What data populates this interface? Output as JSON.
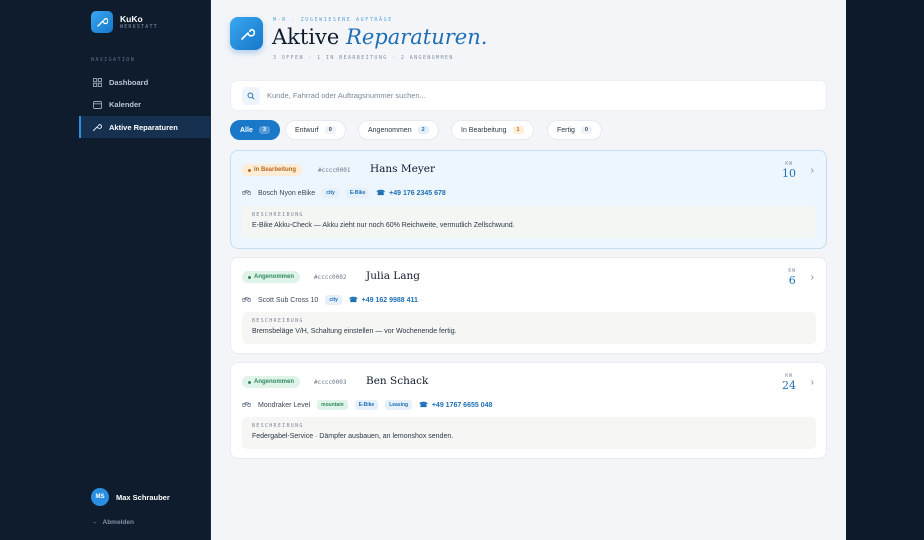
{
  "brand": {
    "name": "KuKo",
    "sub": "WERKSTATT"
  },
  "nav": {
    "heading": "NAVIGATION",
    "items": [
      {
        "label": "Dashboard",
        "icon": "dashboard-icon"
      },
      {
        "label": "Kalender",
        "icon": "calendar-icon"
      },
      {
        "label": "Aktive Reparaturen",
        "icon": "wrench-icon",
        "active": true
      }
    ]
  },
  "user": {
    "initials": "MS",
    "name": "Max Schrauber",
    "logout": "Abmelden"
  },
  "header": {
    "eyebrow": "M-R · ZUGEWIESENE AUFTRÄGE",
    "title_plain": "Aktive",
    "title_accent": "Reparaturen.",
    "subline": "3 OFFEN · 1 IN BEARBEITUNG · 2 ANGENOMMEN"
  },
  "search": {
    "placeholder": "Kunde, Fahrrad oder Auftragsnummer suchen..."
  },
  "filters": [
    {
      "label": "Alle",
      "count": "3",
      "active": true
    },
    {
      "label": "Entwurf",
      "count": "0"
    },
    {
      "label": "Angenommen",
      "count": "2"
    },
    {
      "label": "In Bearbeitung",
      "count": "1"
    },
    {
      "label": "Fertig",
      "count": "0"
    }
  ],
  "desc_label": "BESCHREIBUNG",
  "kw_label": "KW",
  "cards": [
    {
      "status": "In Bearbeitung",
      "order": "#cccc0001",
      "name": "Hans Meyer",
      "bike": "Bosch Nyon eBike",
      "tags": [
        "city",
        "E-Bike"
      ],
      "phone": "+49 176 2345 678",
      "description": "E-Bike Akku-Check — Akku zieht nur noch 60% Reichweite, vermutlich Zellschwund.",
      "kw": "10"
    },
    {
      "status": "Angenommen",
      "order": "#cccc0002",
      "name": "Julia Lang",
      "bike": "Scott Sub Cross 10",
      "tags": [
        "city"
      ],
      "phone": "+49 162 9988 411",
      "description": "Bremsbeläge V/H, Schaltung einstellen — vor Wochenende fertig.",
      "kw": "6"
    },
    {
      "status": "Angenommen",
      "order": "#cccc0003",
      "name": "Ben Schack",
      "bike": "Mondraker Level",
      "tags": [
        "mountain",
        "E-Bike",
        "Leasing"
      ],
      "phone": "+49 1767 6655 048",
      "description": "Federgabel-Service · Dämpfer ausbauen, an lemonshox senden.",
      "kw": "24"
    }
  ]
}
